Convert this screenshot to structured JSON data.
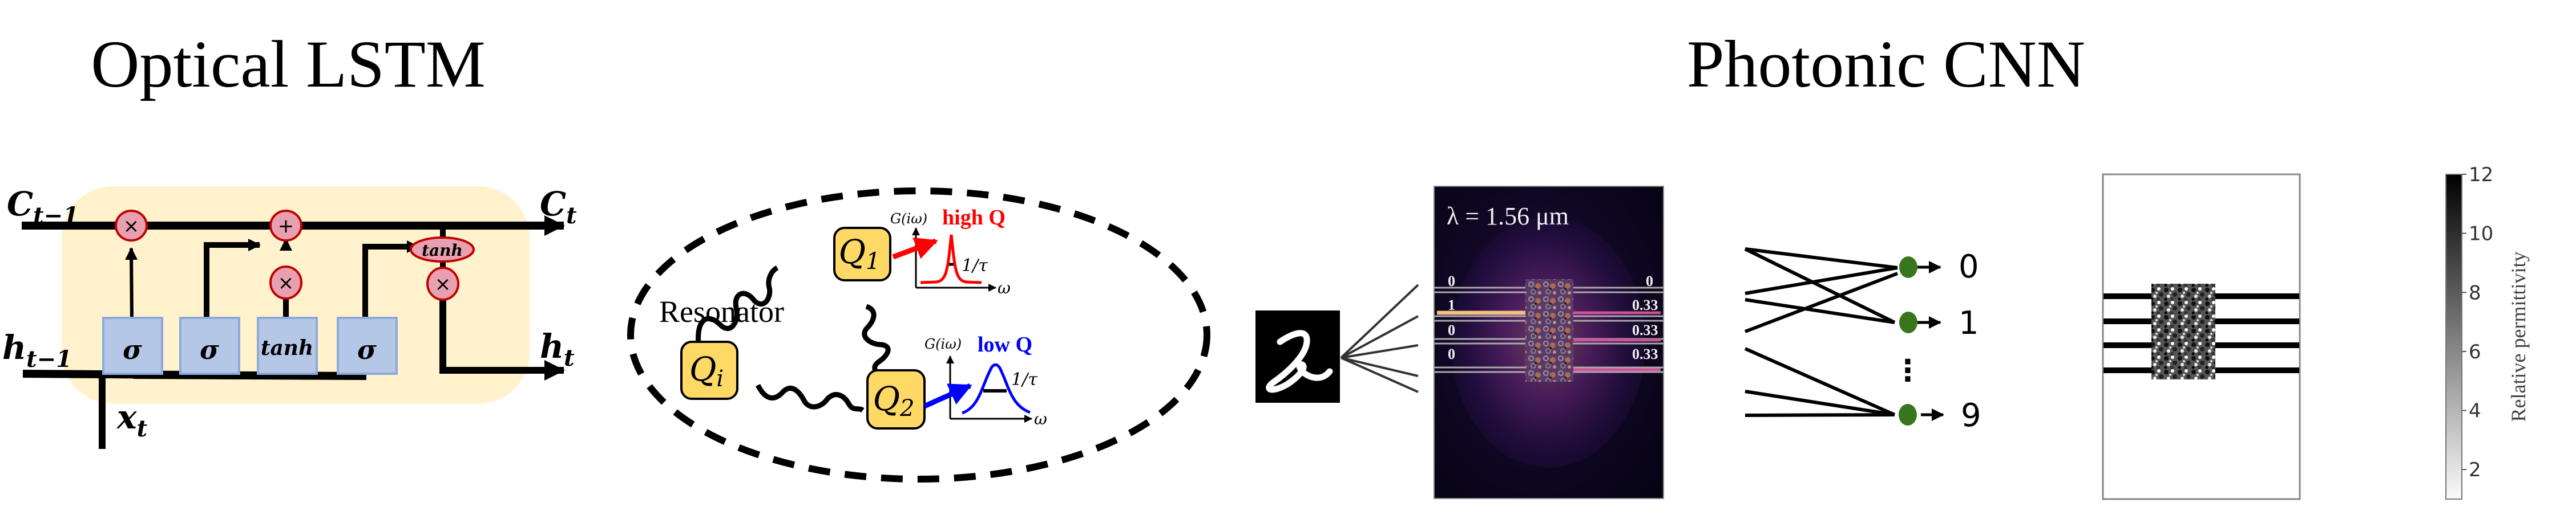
{
  "titles": {
    "left": "Optical LSTM",
    "right": "Photonic CNN"
  },
  "lstm": {
    "inputs": {
      "cell_prev": {
        "base": "C",
        "sub": "t−1"
      },
      "hidden_prev": {
        "base": "h",
        "sub": "t−1"
      },
      "input": {
        "base": "x",
        "sub": "t"
      }
    },
    "outputs": {
      "cell": {
        "base": "C",
        "sub": "t"
      },
      "hidden": {
        "base": "h",
        "sub": "t"
      }
    },
    "gates": [
      "σ",
      "σ",
      "tanh",
      "σ"
    ],
    "operators": {
      "forget_mult": "×",
      "add": "+",
      "input_mult": "×",
      "output_mult": "×",
      "cell_tanh": "tanh"
    },
    "colors": {
      "cell_bg": "#fff2cc",
      "gate_fill": "#b4c7e7",
      "gate_border": "#8eaadb",
      "op_fill": "#e8a0b0",
      "op_border": "#c00000"
    }
  },
  "resonator": {
    "label": "Resonator",
    "nodes": [
      {
        "base": "Q",
        "sub": "i"
      },
      {
        "base": "Q",
        "sub": "1"
      },
      {
        "base": "Q",
        "sub": "2"
      }
    ],
    "plots": [
      {
        "ylabel": "G(iω)",
        "xlabel": "ω",
        "title": "high Q",
        "width_label": "1/τ",
        "color": "#ff0000"
      },
      {
        "ylabel": "G(iω)",
        "xlabel": "ω",
        "title": "low Q",
        "width_label": "1/τ",
        "color": "#0000ff"
      }
    ],
    "node_fill": "#ffd966"
  },
  "cnn": {
    "field_label": "λ = 1.56 μm",
    "input_ports": [
      "0",
      "1",
      "0",
      "0"
    ],
    "output_ports": [
      "0",
      "0.33",
      "0.33",
      "0.33"
    ],
    "classes": [
      "0",
      "1",
      "9"
    ],
    "ellipsis": "⋮",
    "node_color": "#38761d"
  },
  "permittivity": {
    "colorbar_label": "Relative permittivity",
    "ticks": [
      "12",
      "10",
      "8",
      "6",
      "4",
      "2"
    ],
    "range": [
      1,
      12
    ]
  }
}
